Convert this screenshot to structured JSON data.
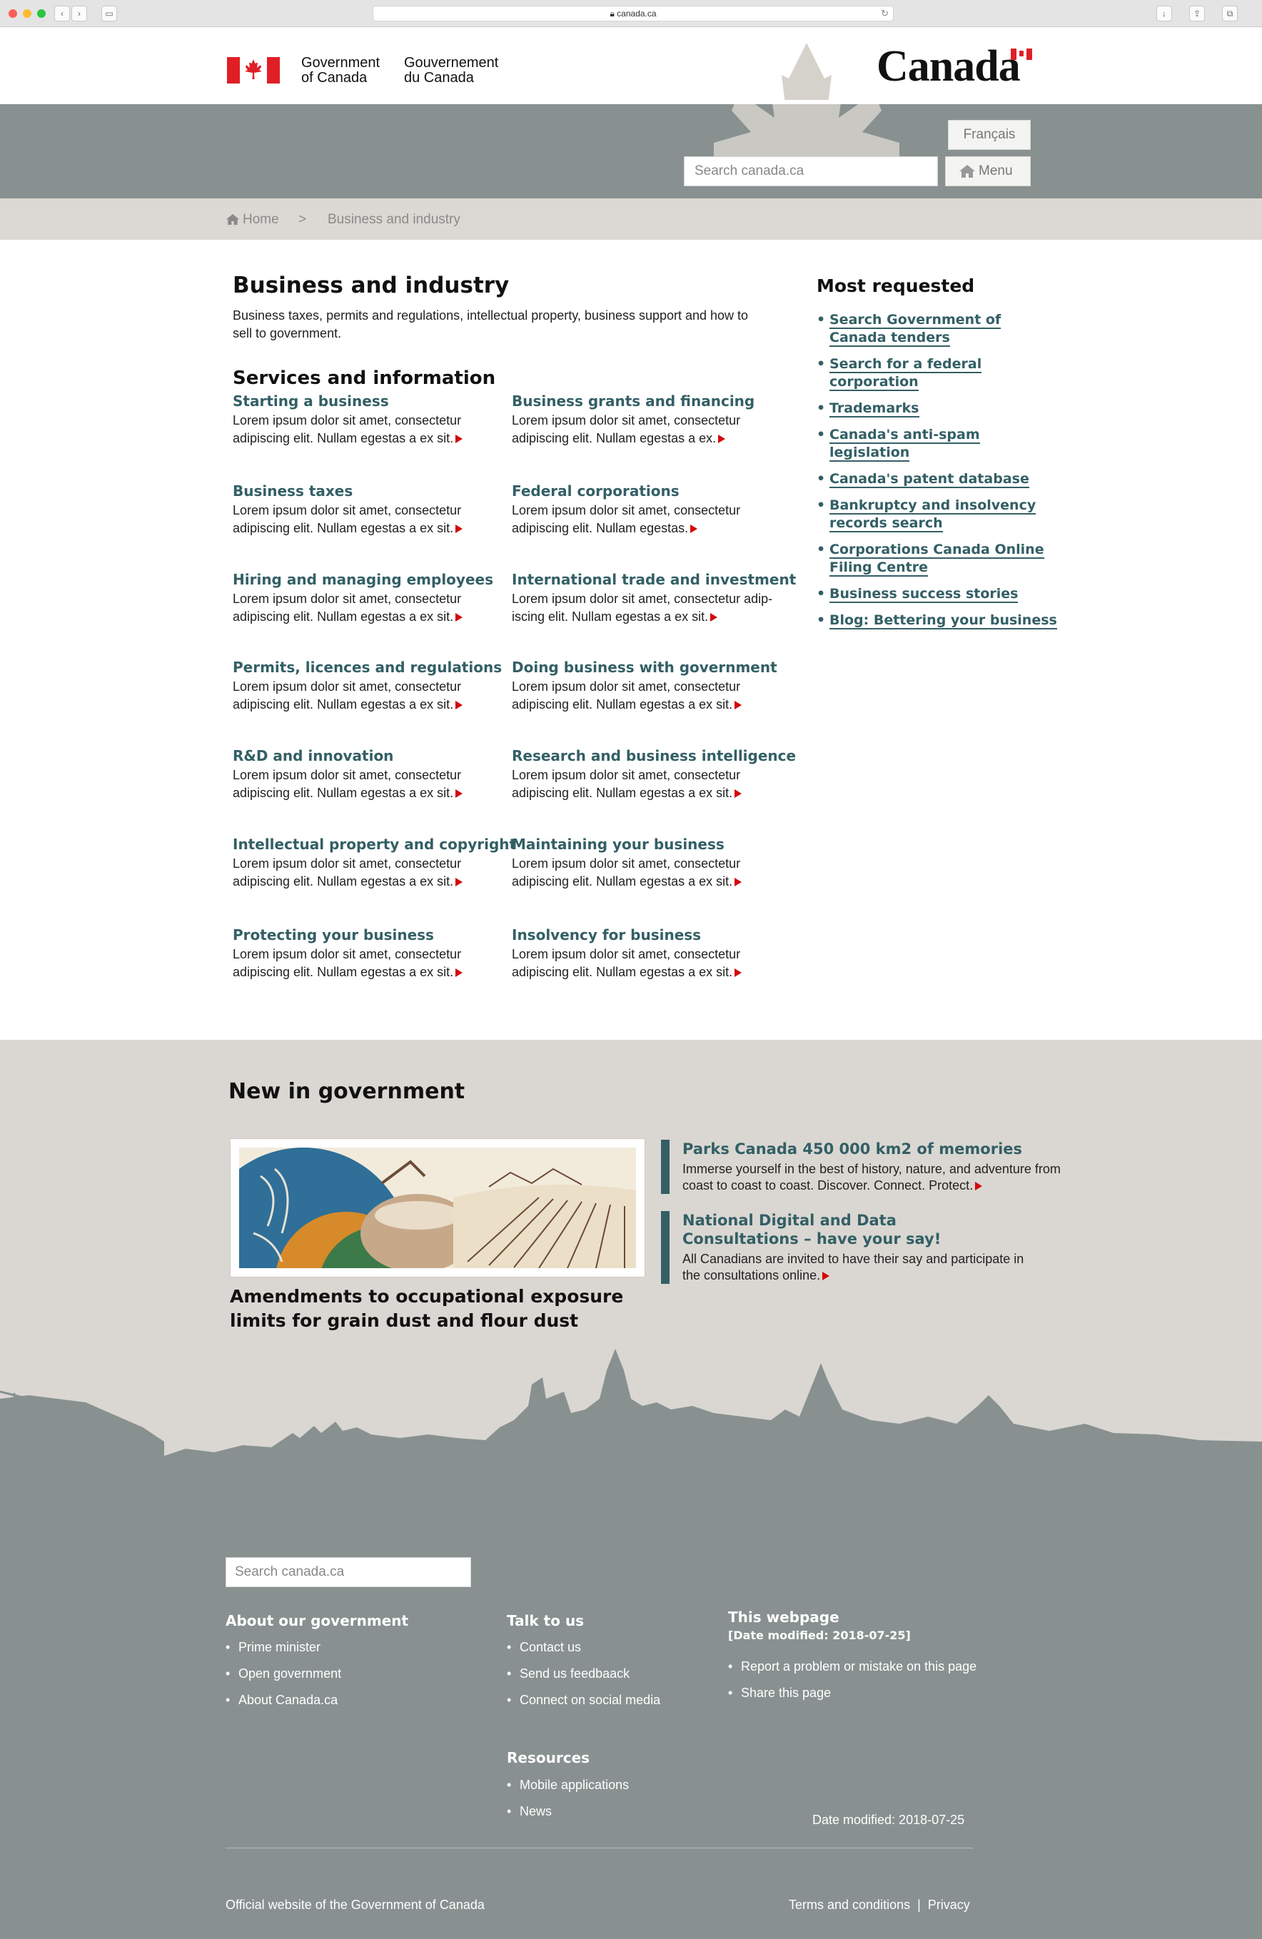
{
  "browser": {
    "url": "canada.ca"
  },
  "header": {
    "wordmark_en_line1": "Government",
    "wordmark_en_line2": "of Canada",
    "wordmark_fr_line1": "Gouvernement",
    "wordmark_fr_line2": "du Canada",
    "logo": "Canada",
    "lang_button": "Français",
    "search_placeholder": "Search canada.ca",
    "menu_button": "Menu"
  },
  "breadcrumb": {
    "home": "Home",
    "separator": ">",
    "current": "Business and industry"
  },
  "main": {
    "title": "Business and industry",
    "intro": "Business taxes, permits and regulations, intellectual property, business support and how to sell to government.",
    "services_heading": "Services and information",
    "services": [
      {
        "title": "Starting a business",
        "desc": "Lorem ipsum dolor sit amet, consectetur adipiscing elit.  Nullam egestas a ex sit."
      },
      {
        "title": "Business grants and financing",
        "desc": "Lorem ipsum dolor sit amet, consectetur adipiscing elit.  Nullam egestas a ex."
      },
      {
        "title": "Business taxes",
        "desc": "Lorem ipsum dolor sit amet, consectetur adipiscing elit.  Nullam egestas a ex sit."
      },
      {
        "title": "Federal corporations",
        "desc": "Lorem ipsum dolor sit amet, consectetur adipiscing elit.  Nullam egestas."
      },
      {
        "title": "Hiring and managing employees",
        "desc": "Lorem ipsum dolor sit amet, consectetur adipiscing elit.  Nullam egestas a ex sit."
      },
      {
        "title": "International trade and investment",
        "desc": "Lorem ipsum dolor sit amet, consectetur adip-iscing elit.  Nullam egestas a ex sit."
      },
      {
        "title": "Permits, licences and regulations",
        "desc": "Lorem ipsum dolor sit amet, consectetur adipiscing elit.  Nullam egestas a ex sit."
      },
      {
        "title": "Doing business with government",
        "desc": "Lorem ipsum dolor sit amet, consectetur adipiscing elit.  Nullam egestas a ex sit."
      },
      {
        "title": "R&D and innovation",
        "desc": "Lorem ipsum dolor sit amet, consectetur adipiscing elit.  Nullam egestas a ex sit."
      },
      {
        "title": "Research and business intelligence",
        "desc": "Lorem ipsum dolor sit amet, consectetur adipiscing elit.  Nullam egestas a ex sit."
      },
      {
        "title": "Intellectual property and copyright",
        "desc": "Lorem ipsum dolor sit amet, consectetur adipiscing elit.  Nullam egestas a ex sit."
      },
      {
        "title": "Maintaining your business",
        "desc": "Lorem ipsum dolor sit amet, consectetur adipiscing elit.  Nullam egestas a ex sit."
      },
      {
        "title": "Protecting your business",
        "desc": "Lorem ipsum dolor sit amet, consectetur adipiscing elit.  Nullam egestas a ex sit."
      },
      {
        "title": "Insolvency for business",
        "desc": "Lorem ipsum dolor sit amet, consectetur adipiscing elit.  Nullam egestas a ex sit."
      }
    ]
  },
  "most_requested": {
    "title": "Most requested",
    "items": [
      "Search Government of Canada tenders",
      "Search for a federal corporation",
      "Trademarks",
      "Canada's anti-spam legislation",
      "Canada's patent database",
      "Bankruptcy and insolvency records search",
      "Corporations Canada Online Filing Centre",
      "Business success stories",
      "Blog: Bettering your business"
    ]
  },
  "new_in_government": {
    "title": "New in government",
    "feature_caption": "Amendments to occupational exposure limits for grain dust and flour dust",
    "news": [
      {
        "title": "Parks Canada 450 000 km2 of memories",
        "desc": "Immerse yourself in the best of history, nature, and adventure from coast to coast to coast. Discover. Connect. Protect."
      },
      {
        "title": "National Digital and Data Consultations – have your say!",
        "desc": "All Canadians are invited to have their say and participate in the consultations online."
      }
    ]
  },
  "footer": {
    "search_placeholder": "Search canada.ca",
    "about": {
      "title": "About our government",
      "items": [
        "Prime minister",
        "Open government",
        "About Canada.ca"
      ]
    },
    "talk": {
      "title": "Talk to us",
      "items": [
        "Contact us",
        "Send us feedbaack",
        "Connect on social media"
      ]
    },
    "webpage": {
      "title": "This webpage",
      "date_label": "[Date modified: 2018-07-25]",
      "items": [
        "Report a problem or mistake on this page",
        "Share this page"
      ]
    },
    "resources": {
      "title": "Resources",
      "items": [
        "Mobile applications",
        "News"
      ]
    },
    "date_modified": "Date modified: 2018-07-25",
    "official": "Official website of the Government of Canada",
    "terms": "Terms and conditions",
    "separator": "|",
    "privacy": "Privacy"
  },
  "colors": {
    "accent": "#335f65",
    "grey": "#889190",
    "beige": "#dad7d2",
    "flag_red": "#e01e25",
    "arrow_red": "#d3080c"
  }
}
